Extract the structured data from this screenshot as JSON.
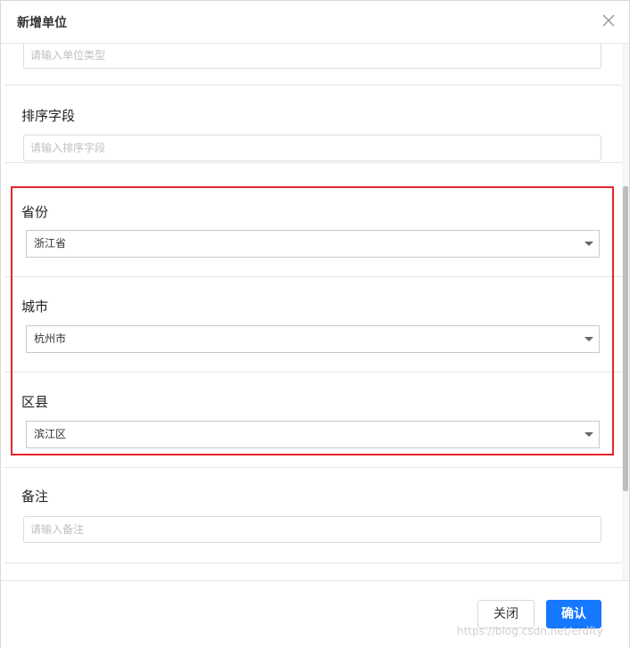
{
  "dialog": {
    "title": "新增单位",
    "close_icon": "close-icon"
  },
  "form": {
    "unit_type": {
      "placeholder": "请输入单位类型"
    },
    "sort_field": {
      "label": "排序字段",
      "placeholder": "请输入排序字段"
    },
    "province": {
      "label": "省份",
      "value": "浙江省"
    },
    "city": {
      "label": "城市",
      "value": "杭州市"
    },
    "district": {
      "label": "区县",
      "value": "滨江区"
    },
    "remark": {
      "label": "备注",
      "placeholder": "请输入备注"
    }
  },
  "footer": {
    "close_label": "关闭",
    "confirm_label": "确认"
  },
  "watermark": "https://blog.csdn.net/erdfty",
  "colors": {
    "highlight": "#e5242b",
    "primary": "#1677ff"
  }
}
